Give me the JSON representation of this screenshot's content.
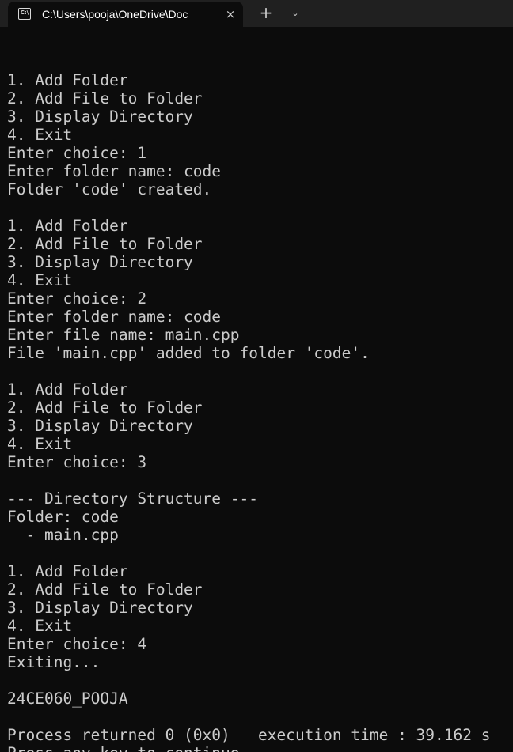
{
  "window": {
    "tab_title": "C:\\Users\\pooja\\OneDrive\\Doc",
    "tab_icon": "terminal-icon",
    "close_icon": "×",
    "new_tab_icon": "+",
    "dropdown_icon": "⌄"
  },
  "terminal": {
    "lines": [
      "",
      "1. Add Folder",
      "2. Add File to Folder",
      "3. Display Directory",
      "4. Exit",
      "Enter choice: 1",
      "Enter folder name: code",
      "Folder 'code' created.",
      "",
      "1. Add Folder",
      "2. Add File to Folder",
      "3. Display Directory",
      "4. Exit",
      "Enter choice: 2",
      "Enter folder name: code",
      "Enter file name: main.cpp",
      "File 'main.cpp' added to folder 'code'.",
      "",
      "1. Add Folder",
      "2. Add File to Folder",
      "3. Display Directory",
      "4. Exit",
      "Enter choice: 3",
      "",
      "--- Directory Structure ---",
      "Folder: code",
      "  - main.cpp",
      "",
      "1. Add Folder",
      "2. Add File to Folder",
      "3. Display Directory",
      "4. Exit",
      "Enter choice: 4",
      "Exiting...",
      "",
      "24CE060_POOJA",
      "",
      "Process returned 0 (0x0)   execution time : 39.162 s",
      "Press any key to continue."
    ]
  },
  "colors": {
    "background": "#0c0c0c",
    "titlebar": "#202020",
    "text": "#cccccc"
  }
}
